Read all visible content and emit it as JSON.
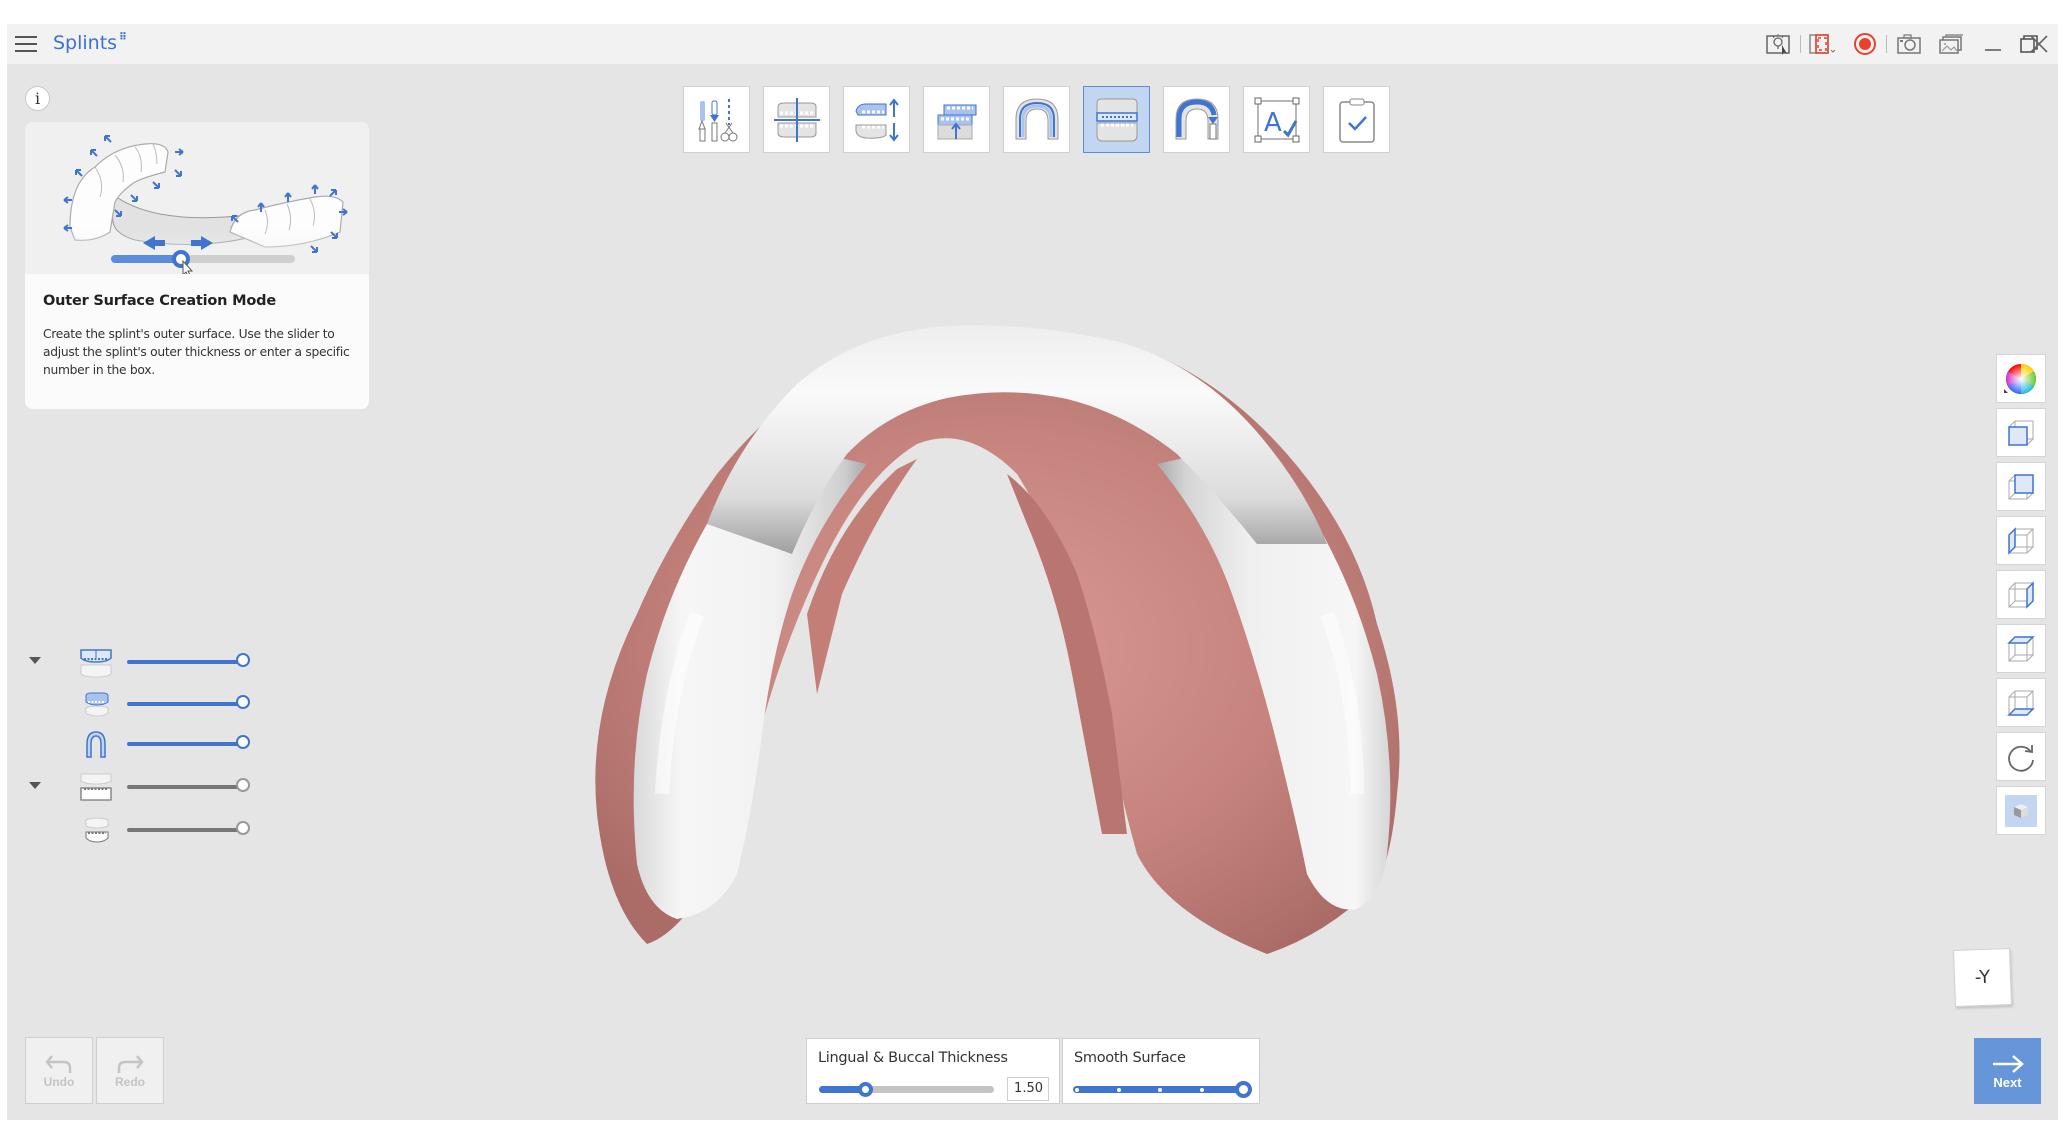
{
  "app": {
    "title": "Splints",
    "title_badge": "⠿",
    "menu_icon": "hamburger-icon"
  },
  "titlebar_icons": [
    {
      "name": "help-guide-icon"
    },
    {
      "name": "capture-region-icon"
    },
    {
      "name": "record-icon",
      "color": "#e8412c"
    },
    {
      "name": "camera-icon"
    },
    {
      "name": "gallery-icon"
    },
    {
      "name": "minimize-icon"
    },
    {
      "name": "restore-icon"
    },
    {
      "name": "close-icon"
    }
  ],
  "tutorial": {
    "title": "Outer Surface Creation Mode",
    "description": "Create the splint's outer surface. Use the slider to adjust the splint's outer thickness or enter a specific number in the box.",
    "illustration_slider_value": 0.38
  },
  "toolbar": {
    "steps": [
      {
        "name": "settings-trim-step",
        "active": false
      },
      {
        "name": "occlusal-plane-step",
        "active": false
      },
      {
        "name": "insertion-direction-step",
        "active": false
      },
      {
        "name": "undercut-fill-step",
        "active": false
      },
      {
        "name": "margin-line-step",
        "active": false
      },
      {
        "name": "outer-surface-step",
        "active": true
      },
      {
        "name": "splint-edit-step",
        "active": false
      },
      {
        "name": "text-label-step",
        "active": false
      },
      {
        "name": "finish-step",
        "active": false
      }
    ]
  },
  "visibility": {
    "rows": [
      {
        "name": "upper-group",
        "has_caret": true,
        "color": "#3f74d1",
        "value": 1.0
      },
      {
        "name": "upper-splint",
        "has_caret": false,
        "color": "#3f74d1",
        "value": 1.0
      },
      {
        "name": "margin-arch",
        "has_caret": false,
        "color": "#3f74d1",
        "value": 1.0
      },
      {
        "name": "lower-group",
        "has_caret": true,
        "color": "#777777",
        "value": 1.0
      },
      {
        "name": "lower-scan",
        "has_caret": false,
        "color": "#777777",
        "value": 1.0
      }
    ]
  },
  "view_panel": {
    "buttons": [
      {
        "name": "color-picker-icon"
      },
      {
        "name": "front-view-icon"
      },
      {
        "name": "back-view-icon"
      },
      {
        "name": "left-view-icon"
      },
      {
        "name": "right-view-icon"
      },
      {
        "name": "top-view-icon"
      },
      {
        "name": "bottom-view-icon"
      },
      {
        "name": "rotate-view-icon"
      },
      {
        "name": "solid-view-icon"
      }
    ]
  },
  "axis_cube": {
    "label": "-Y"
  },
  "history": {
    "undo_label": "Undo",
    "redo_label": "Redo"
  },
  "params": {
    "thickness": {
      "label": "Lingual & Buccal Thickness",
      "value": "1.50",
      "slider_fraction": 0.26
    },
    "smooth": {
      "label": "Smooth Surface",
      "steps": 5,
      "current_step": 5
    }
  },
  "next": {
    "label": "Next"
  },
  "colors": {
    "accent": "#3f74d1",
    "accent_light": "#c2d6f2",
    "next_bg": "#6795da",
    "background": "#e5e5e5",
    "titlebar": "#f2f2f2",
    "gum": "#c9817a",
    "splint": "#f2f2f2"
  }
}
